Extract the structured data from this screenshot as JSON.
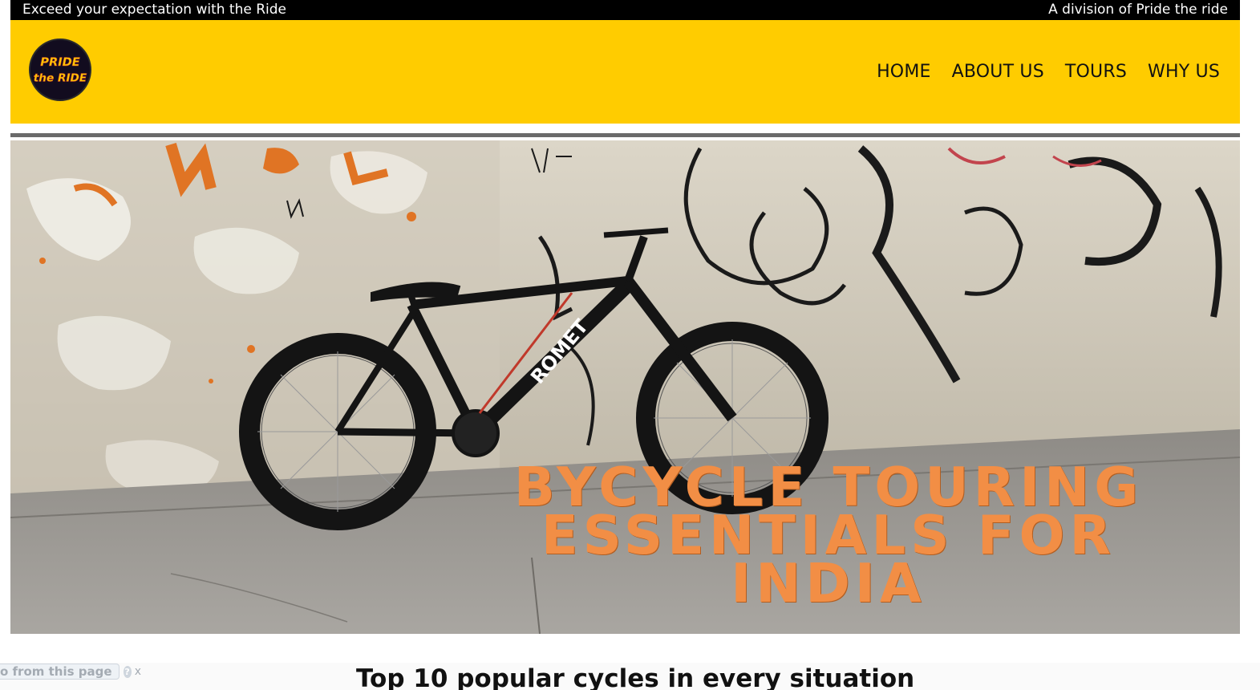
{
  "topbar": {
    "tagline": "Exceed your expectation with the Ride",
    "division": "A division of Pride the ride"
  },
  "logo": {
    "line1": "PRIDE",
    "line2": "the RIDE"
  },
  "nav": {
    "items": [
      "HOME",
      "ABOUT US",
      "TOURS",
      "WHY US"
    ]
  },
  "hero": {
    "title_line1": "BYCYCLE TOURING",
    "title_line2": "ESSENTIALS FOR",
    "title_line3": "INDIA",
    "frame_text": "ROMET"
  },
  "translate": {
    "link_text": "o from this page",
    "help_label": "?",
    "close_label": "x"
  },
  "section": {
    "heading": "Top 10 popular cycles in every situation"
  },
  "colors": {
    "header_bg": "#ffcc00",
    "topbar_bg": "#000000",
    "hero_title": "#f28e45"
  }
}
